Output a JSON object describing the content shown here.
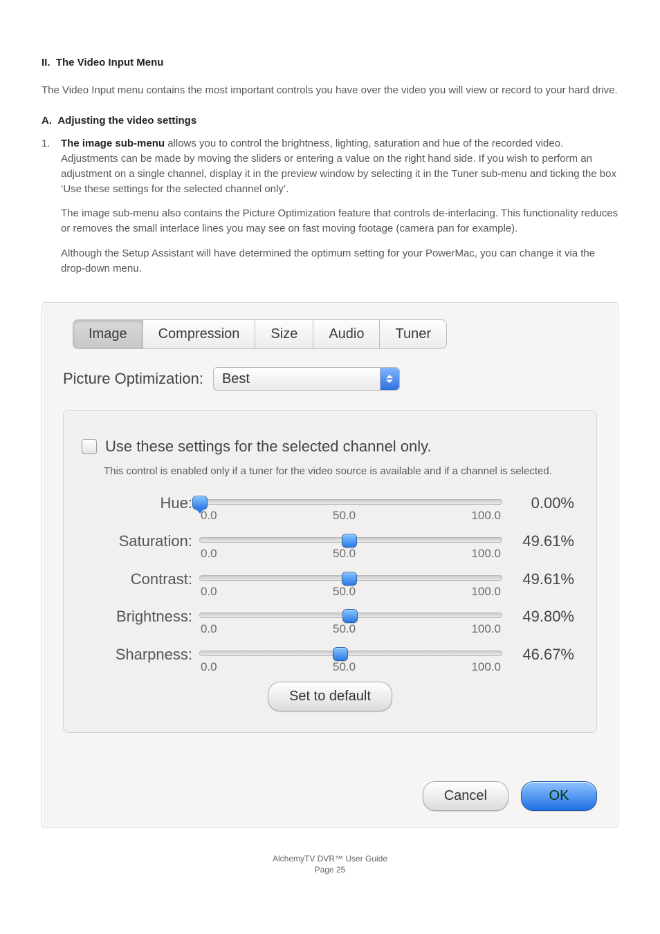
{
  "doc": {
    "heading": "II.  The Video Input Menu",
    "intro": "The Video Input menu contains the most important controls you have over the video you will view or record to your hard drive.",
    "sub_heading": "A.  Adjusting the video settings",
    "list_number": "1.",
    "bold_lead": "The image sub-menu",
    "p1_rest": " allows you to control the brightness, lighting, saturation and hue of the recorded video. Adjustments can be made by moving the sliders or entering a value on the right hand side. If you wish to perform an adjustment on a single channel, display it in the preview window by selecting it in the Tuner sub-menu and ticking the box ‘Use these settings for the selected channel only’.",
    "p2": "The image sub-menu also contains the Picture Optimization feature that controls de-interlacing. This functionality reduces or removes the small interlace lines you may see on fast moving footage (camera pan for example).",
    "p3": "Although the Setup Assistant will have determined the optimum setting for your PowerMac, you can change it via the drop-down menu."
  },
  "dialog": {
    "tabs": {
      "image": "Image",
      "compression": "Compression",
      "size": "Size",
      "audio": "Audio",
      "tuner": "Tuner"
    },
    "picture_opt_label": "Picture Optimization:",
    "picture_opt_value": "Best",
    "checkbox_label": "Use these settings for the selected channel only.",
    "hint": "This control is enabled only if a tuner for the video source is available and if a channel is selected.",
    "sliders": {
      "hue": {
        "label": "Hue:",
        "min": "0.0",
        "mid": "50.0",
        "max": "100.0",
        "value": "0.00%",
        "percent": 0.0
      },
      "saturation": {
        "label": "Saturation:",
        "min": "0.0",
        "mid": "50.0",
        "max": "100.0",
        "value": "49.61%",
        "percent": 49.61
      },
      "contrast": {
        "label": "Contrast:",
        "min": "0.0",
        "mid": "50.0",
        "max": "100.0",
        "value": "49.61%",
        "percent": 49.61
      },
      "brightness": {
        "label": "Brightness:",
        "min": "0.0",
        "mid": "50.0",
        "max": "100.0",
        "value": "49.80%",
        "percent": 49.8
      },
      "sharpness": {
        "label": "Sharpness:",
        "min": "0.0",
        "mid": "50.0",
        "max": "100.0",
        "value": "46.67%",
        "percent": 46.67
      }
    },
    "set_default": "Set to default",
    "cancel": "Cancel",
    "ok": "OK"
  },
  "footer": {
    "line1": "AlchemyTV DVR™ User Guide",
    "line2_prefix": "Page ",
    "page": "25"
  }
}
